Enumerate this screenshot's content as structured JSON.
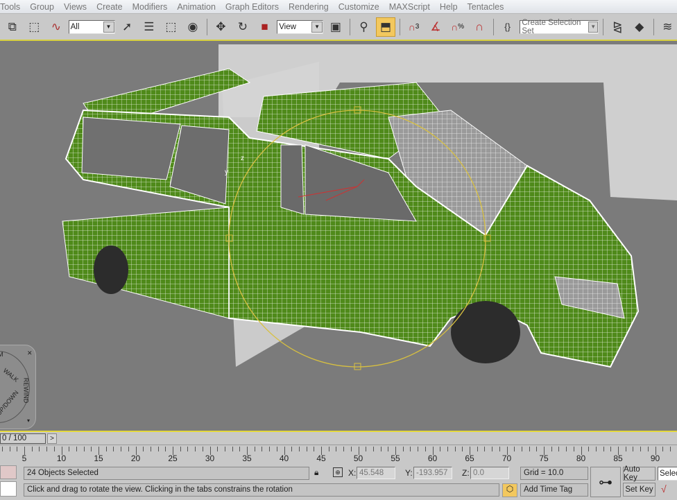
{
  "menu": [
    "Tools",
    "Group",
    "Views",
    "Create",
    "Modifiers",
    "Animation",
    "Graph Editors",
    "Rendering",
    "Customize",
    "MAXScript",
    "Help",
    "Tentacles"
  ],
  "toolbar": {
    "selection_filter": "All",
    "reference_coord": "View",
    "named_selection_placeholder": "Create Selection Set",
    "snap_angle_label": "3",
    "percent_snap_label": "%"
  },
  "viewport": {
    "wheel_labels": {
      "walk": "WALK",
      "rewind": "REWIND",
      "updown": "UP/DOWN",
      "m": "M"
    },
    "axis_y": "y",
    "axis_z": "z",
    "accent": "#d8c040",
    "mesh_color": "#4f8a1a"
  },
  "timeslider": {
    "frame": "0 / 100",
    "next": ">"
  },
  "ruler": {
    "ticks": [
      "5",
      "10",
      "15",
      "20",
      "25",
      "30",
      "35",
      "40",
      "45",
      "50",
      "55",
      "60",
      "65",
      "70",
      "75",
      "80",
      "85",
      "90"
    ]
  },
  "status": {
    "selection": "24 Objects Selected",
    "prompt": "Click and drag to rotate the view.  Clicking in the tabs constrains the rotation",
    "x_label": "X:",
    "x": "45.548",
    "y_label": "Y:",
    "y": "-193.957",
    "z_label": "Z:",
    "z": "0.0",
    "grid": "Grid = 10.0",
    "add_time_tag": "Add Time Tag",
    "auto_key": "Auto Key",
    "set_key": "Set Key",
    "key_filter": "Selected"
  }
}
